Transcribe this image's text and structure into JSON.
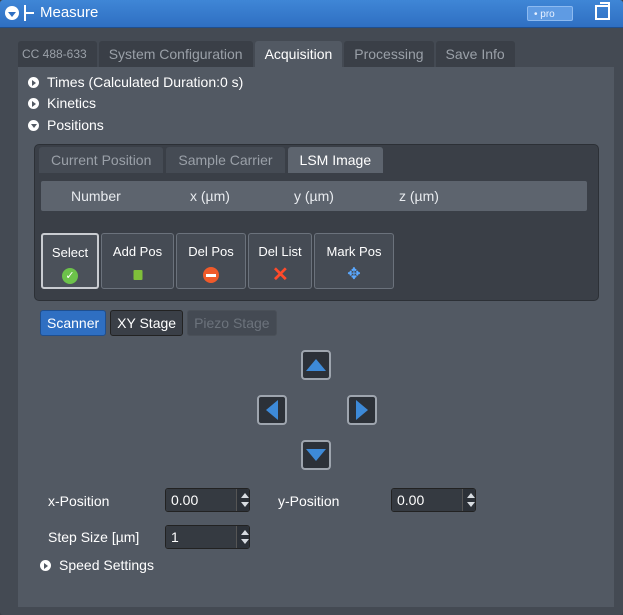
{
  "titlebar": {
    "title": "Measure",
    "badge": "• pro"
  },
  "main_tabs": [
    {
      "label": "CC 488-633",
      "active": false
    },
    {
      "label": "System Configuration",
      "active": false
    },
    {
      "label": "Acquisition",
      "active": true
    },
    {
      "label": "Processing",
      "active": false
    },
    {
      "label": "Save Info",
      "active": false
    }
  ],
  "expanders": {
    "times": "Times (Calculated Duration:0 s)",
    "kinetics": "Kinetics",
    "positions": "Positions",
    "speed": "Speed Settings"
  },
  "sub_tabs": [
    {
      "label": "Current Position",
      "active": false
    },
    {
      "label": "Sample Carrier",
      "active": false
    },
    {
      "label": "LSM Image",
      "active": true
    }
  ],
  "table": {
    "columns": [
      "Number",
      "x (µm)",
      "y (µm)",
      "z (µm)"
    ]
  },
  "tools": [
    {
      "label": "Select",
      "icon": "check-icon",
      "selected": true
    },
    {
      "label": "Add Pos",
      "icon": "lock-icon",
      "selected": false
    },
    {
      "label": "Del Pos",
      "icon": "minus-circle-icon",
      "selected": false
    },
    {
      "label": "Del List",
      "icon": "x-icon",
      "selected": false
    },
    {
      "label": "Mark Pos",
      "icon": "move-icon",
      "selected": false
    }
  ],
  "modes": [
    {
      "label": "Scanner",
      "state": "active"
    },
    {
      "label": "XY Stage",
      "state": "normal"
    },
    {
      "label": "Piezo Stage",
      "state": "disabled"
    }
  ],
  "fields": {
    "x_label": "x-Position",
    "x_value": "0.00",
    "y_label": "y-Position",
    "y_value": "0.00",
    "step_label": "Step Size [µm]",
    "step_value": "1"
  },
  "colors": {
    "accent": "#2f6fc2",
    "arrow": "#3d8ad8",
    "panel": "#525963"
  }
}
